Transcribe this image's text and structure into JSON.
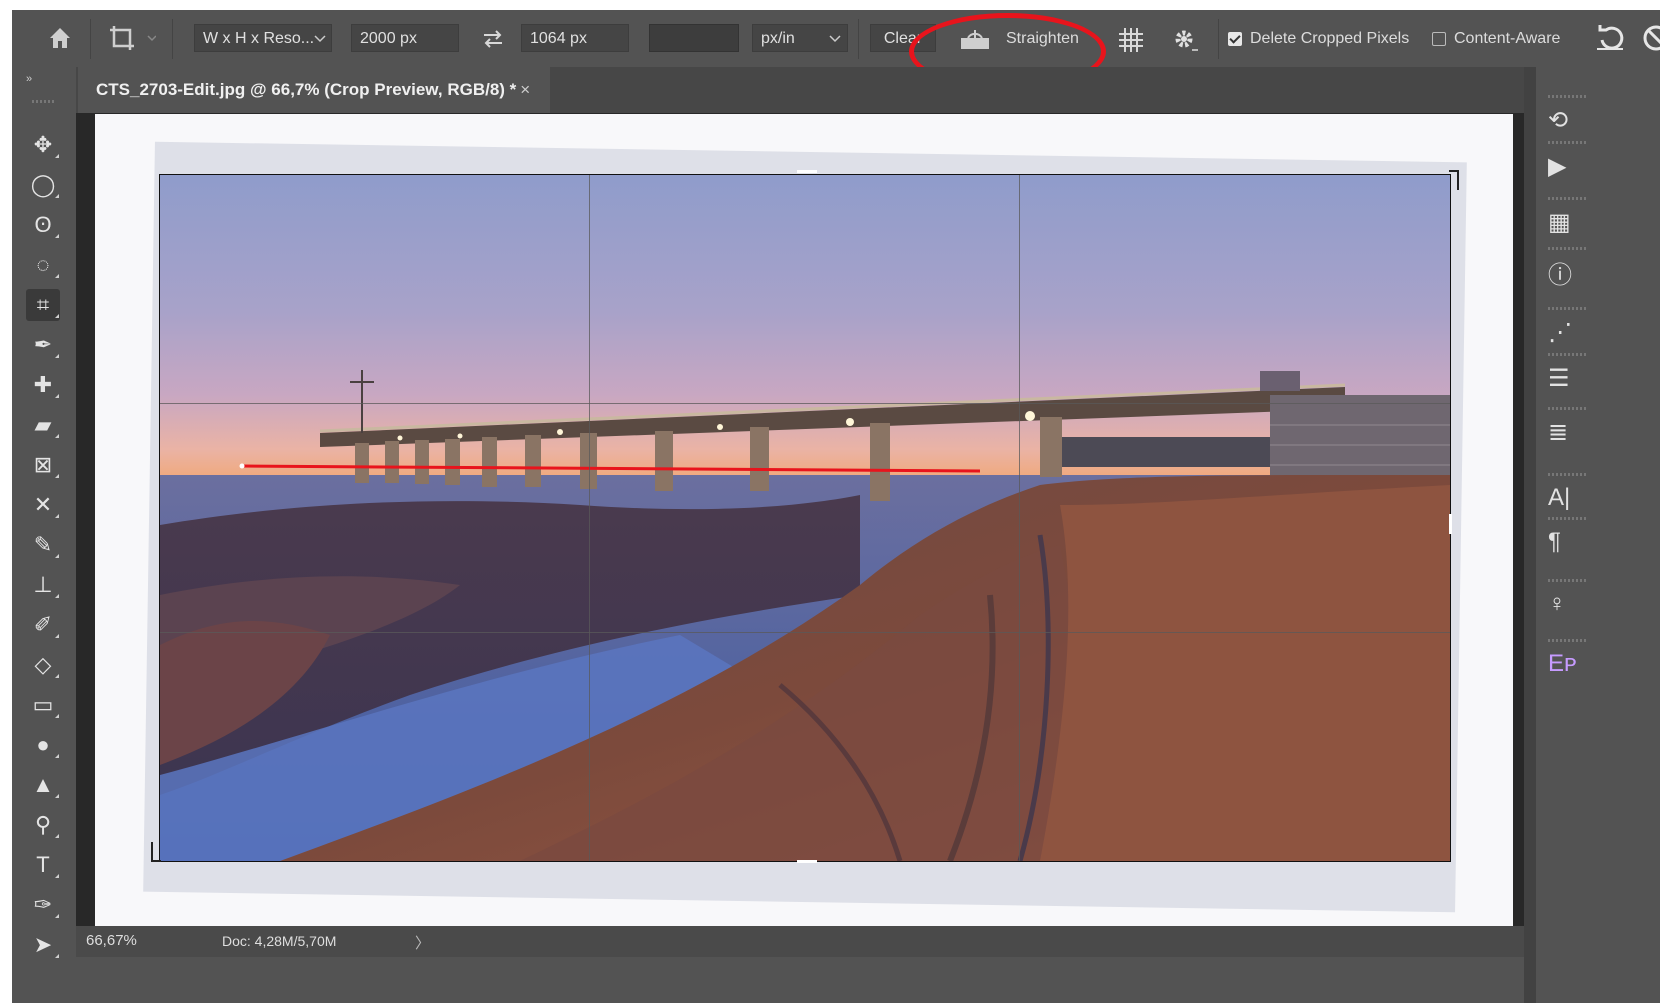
{
  "options_bar": {
    "ratio_select": "W x H x Reso...",
    "width_value": "2000 px",
    "height_value": "1064 px",
    "resolution_value": "",
    "unit_select": "px/in",
    "clear_label": "Clear",
    "straighten_label": "Straighten",
    "delete_cropped_label": "Delete Cropped Pixels",
    "delete_cropped_checked": true,
    "content_aware_label": "Content-Aware",
    "content_aware_checked": false
  },
  "document": {
    "tab_title": "CTS_2703-Edit.jpg @ 66,7% (Crop Preview, RGB/8) *",
    "tab_close": "×"
  },
  "status": {
    "zoom": "66,67%",
    "doc_size": "Doc: 4,28M/5,70M",
    "arrow": "〉"
  },
  "tools": [
    {
      "name": "move-tool",
      "icon": "✥"
    },
    {
      "name": "marquee-tool",
      "icon": "◯"
    },
    {
      "name": "lasso-tool",
      "icon": "ʘ"
    },
    {
      "name": "quick-selection-tool",
      "icon": "◌"
    },
    {
      "name": "crop-tool",
      "icon": "⌗"
    },
    {
      "name": "eyedropper-tool",
      "icon": "✒"
    },
    {
      "name": "healing-brush-tool",
      "icon": "✚"
    },
    {
      "name": "patch-tool",
      "icon": "▰"
    },
    {
      "name": "frame-tool",
      "icon": "⊠"
    },
    {
      "name": "content-aware-move-tool",
      "icon": "✕"
    },
    {
      "name": "brush-tool",
      "icon": "✎"
    },
    {
      "name": "clone-stamp-tool",
      "icon": "⊥"
    },
    {
      "name": "history-brush-tool",
      "icon": "✐"
    },
    {
      "name": "eraser-tool",
      "icon": "◇"
    },
    {
      "name": "gradient-tool",
      "icon": "▭"
    },
    {
      "name": "blur-tool",
      "icon": "●"
    },
    {
      "name": "sharpen-tool",
      "icon": "▲"
    },
    {
      "name": "dodge-tool",
      "icon": "⚲"
    },
    {
      "name": "type-tool",
      "icon": "T"
    },
    {
      "name": "pen-tool",
      "icon": "✑"
    },
    {
      "name": "path-selection-tool",
      "icon": "➤"
    }
  ],
  "right_panels": [
    {
      "name": "history-panel-icon",
      "icon": "⟲"
    },
    {
      "name": "actions-panel-icon",
      "icon": "▶"
    },
    {
      "name": "libraries-panel-icon",
      "icon": "▦"
    },
    {
      "name": "info-panel-icon",
      "icon": "ⓘ"
    },
    {
      "name": "brushes-panel-icon",
      "icon": "⋰"
    },
    {
      "name": "adjustments-panel-icon",
      "icon": "☰"
    },
    {
      "name": "properties-panel-icon",
      "icon": "≣"
    },
    {
      "name": "character-panel-icon",
      "icon": "A|"
    },
    {
      "name": "paragraph-panel-icon",
      "icon": "¶"
    },
    {
      "name": "learn-panel-icon",
      "icon": "♀"
    },
    {
      "name": "plugin-panel-icon",
      "icon": "Eᴘ"
    }
  ],
  "colors": {
    "app_bg": "#535353",
    "canvas_bg": "#282828",
    "highlight_red": "#e8141c",
    "horizon_line_red": "#e8141c"
  }
}
